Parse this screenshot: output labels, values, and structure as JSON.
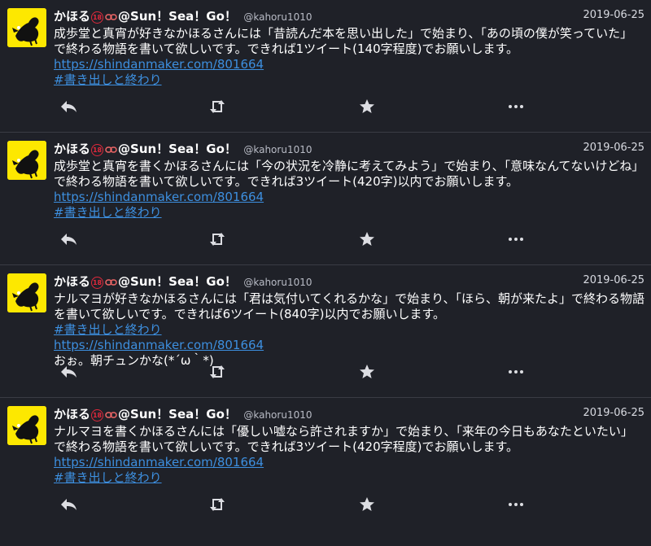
{
  "tweets": [
    {
      "name": "かほる",
      "badge": "18",
      "name_suffix": "@Sun！Sea！Go！",
      "handle": "@kahoru1010",
      "date": "2019-06-25",
      "text": "成歩堂と真宵が好きなかほるさんには「昔読んだ本を思い出した」で始まり、「あの頃の僕が笑っていた」で終わる物語を書いて欲しいです。できれば1ツイート(140字程度)でお願いします。",
      "link1": "https://shindanmaker.com/801664",
      "link2": "#書き出しと終わり",
      "extra": ""
    },
    {
      "name": "かほる",
      "badge": "18",
      "name_suffix": "@Sun！Sea！Go！",
      "handle": "@kahoru1010",
      "date": "2019-06-25",
      "text": "成歩堂と真宵を書くかほるさんには「今の状況を冷静に考えてみよう」で始まり、「意味なんてないけどね」で終わる物語を書いて欲しいです。できれば3ツイート(420字)以内でお願いします。",
      "link1": "https://shindanmaker.com/801664",
      "link2": "#書き出しと終わり",
      "extra": ""
    },
    {
      "name": "かほる",
      "badge": "18",
      "name_suffix": "@Sun！Sea！Go！",
      "handle": "@kahoru1010",
      "date": "2019-06-25",
      "text": "ナルマヨが好きなかほるさんには「君は気付いてくれるかな」で始まり、「ほら、朝が来たよ」で終わる物語を書いて欲しいです。できれば6ツイート(840字)以内でお願いします。",
      "link1": "#書き出しと終わり",
      "link2": "https://shindanmaker.com/801664",
      "extra": "おぉ。朝チュンかな(*´ω｀*)"
    },
    {
      "name": "かほる",
      "badge": "18",
      "name_suffix": "@Sun！Sea！Go！",
      "handle": "@kahoru1010",
      "date": "2019-06-25",
      "text": "ナルマヨを書くかほるさんには「優しい嘘なら許されますか」で始まり、「来年の今日もあなたといたい」で終わる物語を書いて欲しいです。できれば3ツイート(420字程度)でお願いします。",
      "link1": "https://shindanmaker.com/801664",
      "link2": "#書き出しと終わり",
      "extra": ""
    }
  ],
  "icons": [
    "avatar-image",
    "link-chain-icon",
    "reply-icon",
    "retweet-icon",
    "favorite-star-icon",
    "more-icon"
  ],
  "colors": {
    "background": "#1f2128",
    "link": "#3d8fdf",
    "badge": "#e0293c",
    "avatar": "#fde800"
  }
}
